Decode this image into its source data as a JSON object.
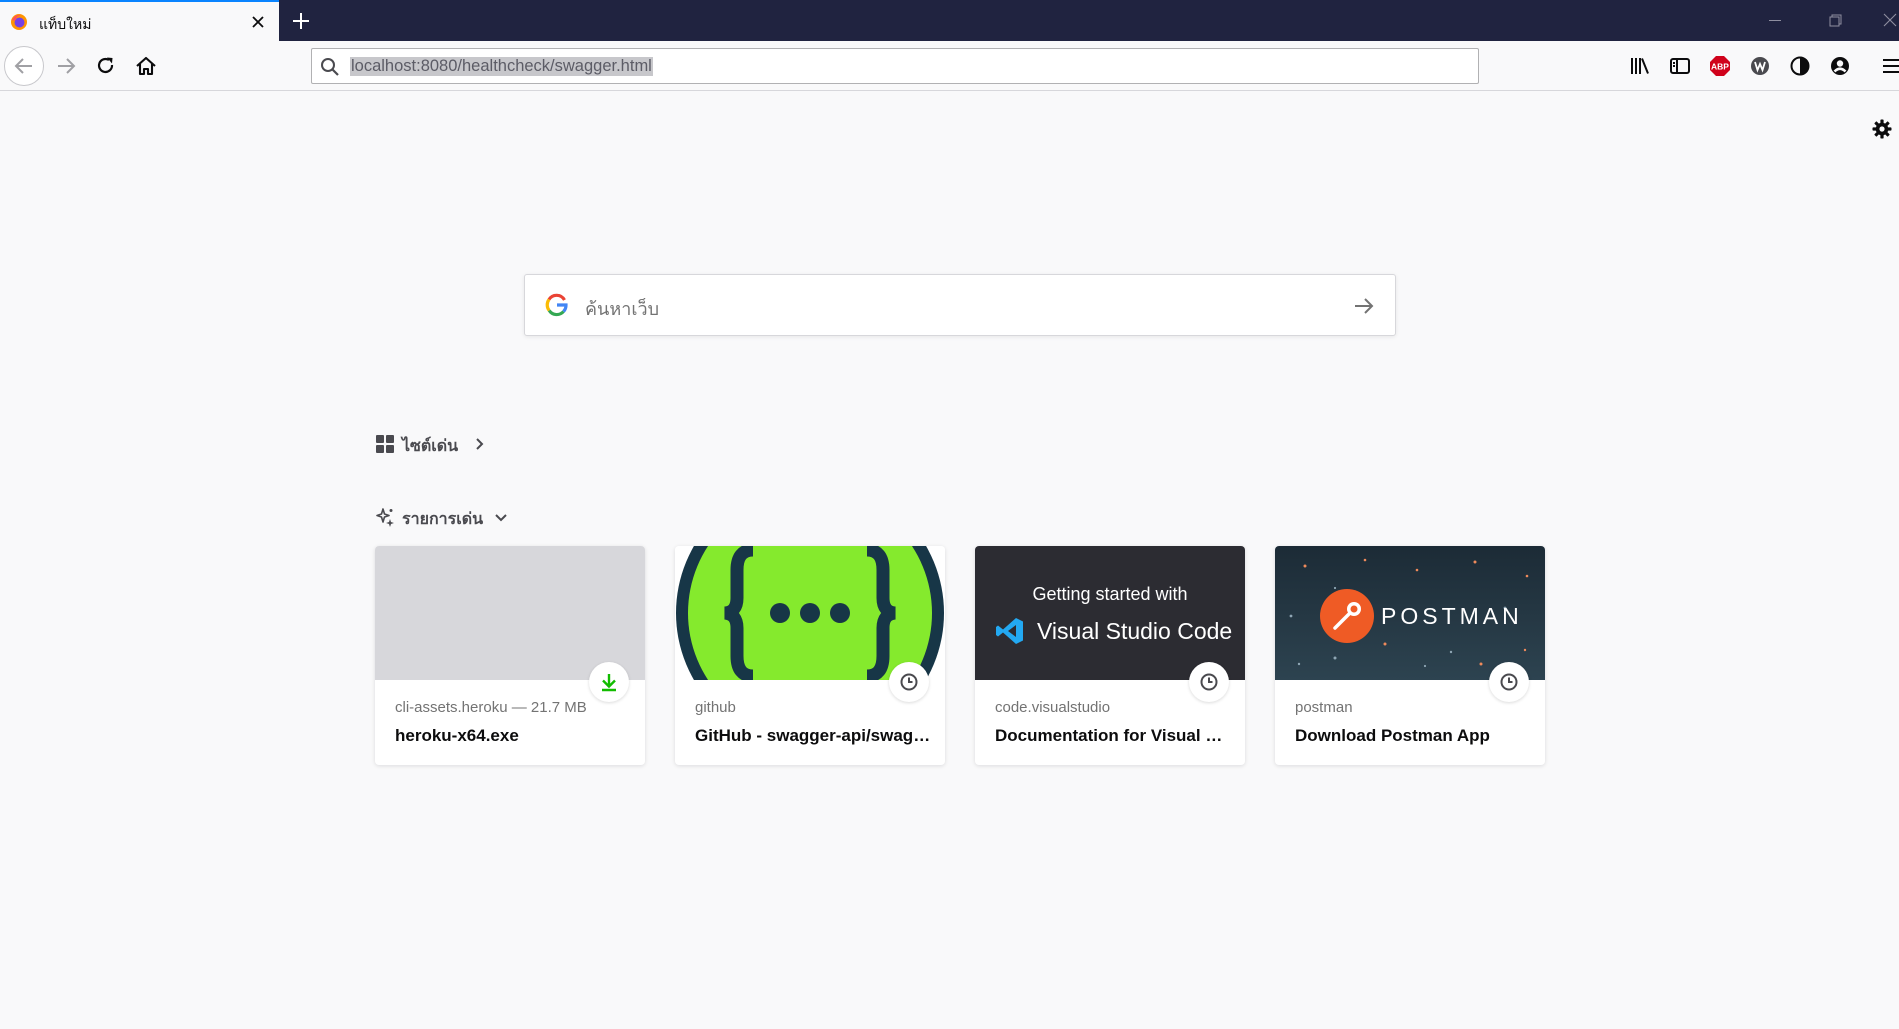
{
  "tab": {
    "title": "แท็บใหม่"
  },
  "urlbar": {
    "value": "localhost:8080/healthcheck/swagger.html"
  },
  "search": {
    "placeholder": "ค้นหาเว็บ"
  },
  "topsites": {
    "label": "ไซต์เด่น"
  },
  "highlights": {
    "label": "รายการเด่น",
    "cards": [
      {
        "host": "cli-assets.heroku — 21.7 MB",
        "title": "heroku-x64.exe",
        "badge": "download-icon"
      },
      {
        "host": "github",
        "title": "GitHub - swagger-api/swagger-ui: Swagger UI",
        "badge": "history-clock-icon"
      },
      {
        "host": "code.visualstudio",
        "title": "Documentation for Visual Studio Code",
        "badge": "history-clock-icon"
      },
      {
        "host": "postman",
        "title": "Download Postman App",
        "badge": "history-clock-icon"
      }
    ],
    "vscode_thumb": {
      "line1": "Getting started with",
      "line2": "Visual Studio Code"
    },
    "postman_thumb": {
      "wordmark": "POSTMAN"
    }
  },
  "toolbar": {
    "abp_badge": "ABP"
  },
  "colors": {
    "tabstrip": "#202340",
    "accent": "#0a84ff",
    "swagger_green": "#85ea2d",
    "vscode_bg": "#2c2c32",
    "postman_orange": "#ef5b25",
    "download_green": "#12bc00"
  }
}
